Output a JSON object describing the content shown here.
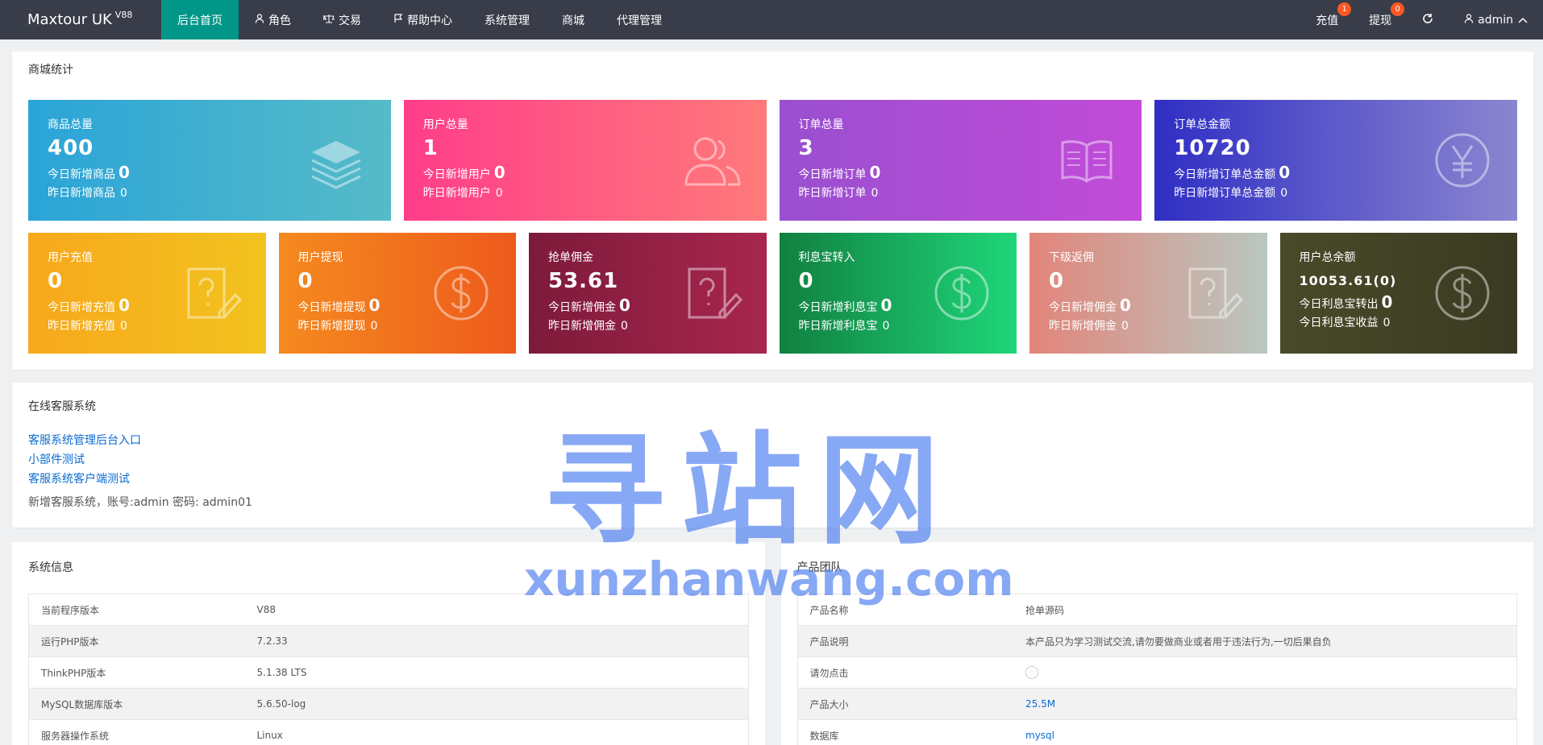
{
  "app": {
    "title": "Maxtour UK",
    "version": "V88"
  },
  "nav": [
    {
      "label": "后台首页",
      "icon": "",
      "active": true
    },
    {
      "label": "角色",
      "icon": "user-icon"
    },
    {
      "label": "交易",
      "icon": "scale-icon"
    },
    {
      "label": "帮助中心",
      "icon": "flag-icon"
    },
    {
      "label": "系统管理",
      "icon": ""
    },
    {
      "label": "商城",
      "icon": ""
    },
    {
      "label": "代理管理",
      "icon": ""
    }
  ],
  "right_nav": {
    "recharge": {
      "label": "充值",
      "badge": "1"
    },
    "withdraw": {
      "label": "提现",
      "badge": "0"
    },
    "refresh_icon": "refresh-icon",
    "user": {
      "label": "admin"
    }
  },
  "stats": {
    "title": "商城统计",
    "row1": [
      {
        "title": "商品总量",
        "value": "400",
        "l1_label": "今日新增商品",
        "l1_value": "0",
        "l2_label": "昨日新增商品",
        "l2_value": "0",
        "icon": "layers-icon",
        "color": "#2aa4d8"
      },
      {
        "title": "用户总量",
        "value": "1",
        "l1_label": "今日新增用户",
        "l1_value": "0",
        "l2_label": "昨日新增用户",
        "l2_value": "0",
        "icon": "users-icon",
        "color": "#ff3d8a"
      },
      {
        "title": "订单总量",
        "value": "3",
        "l1_label": "今日新增订单",
        "l1_value": "0",
        "l2_label": "昨日新增订单",
        "l2_value": "0",
        "icon": "book-icon",
        "color": "#9a4fd0"
      },
      {
        "title": "订单总金额",
        "value": "10720",
        "l1_label": "今日新增订单总金额",
        "l1_value": "0",
        "l2_label": "昨日新增订单总金额",
        "l2_value": "0",
        "icon": "yen-icon",
        "color": "#2f2ec4"
      }
    ],
    "row2": [
      {
        "title": "用户充值",
        "value": "0",
        "l1_label": "今日新增充值",
        "l1_value": "0",
        "l2_label": "昨日新增充值",
        "l2_value": "0",
        "icon": "question-note-icon",
        "color": "#f7a81c"
      },
      {
        "title": "用户提现",
        "value": "0",
        "l1_label": "今日新增提现",
        "l1_value": "0",
        "l2_label": "昨日新增提现",
        "l2_value": "0",
        "icon": "dollar-icon",
        "color": "#f58a1f"
      },
      {
        "title": "抢单佣金",
        "value": "53.61",
        "l1_label": "今日新增佣金",
        "l1_value": "0",
        "l2_label": "昨日新增佣金",
        "l2_value": "0",
        "icon": "question-note-icon",
        "color": "#7d1a3a"
      },
      {
        "title": "利息宝转入",
        "value": "0",
        "l1_label": "今日新增利息宝",
        "l1_value": "0",
        "l2_label": "昨日新增利息宝",
        "l2_value": "0",
        "icon": "dollar-icon",
        "color": "#118040"
      },
      {
        "title": "下级返佣",
        "value": "0",
        "l1_label": "今日新增佣金",
        "l1_value": "0",
        "l2_label": "昨日新增佣金",
        "l2_value": "0",
        "icon": "question-note-icon",
        "color": "#e2857a"
      },
      {
        "title": "用户总余额",
        "value": "10053.61(0)",
        "l1_label": "今日利息宝转出",
        "l1_value": "0",
        "l2_label": "今日利息宝收益",
        "l2_value": "0",
        "icon": "dollar-icon",
        "color": "#4a4a2a"
      }
    ]
  },
  "service": {
    "title": "在线客服系统",
    "links": [
      "客服系统管理后台入口",
      "小部件测试",
      "客服系统客户端测试"
    ],
    "note": "新增客服系统，账号:admin 密码: admin01"
  },
  "system_info": {
    "title": "系统信息",
    "rows": [
      {
        "k": "当前程序版本",
        "v": "V88"
      },
      {
        "k": "运行PHP版本",
        "v": "7.2.33"
      },
      {
        "k": "ThinkPHP版本",
        "v": "5.1.38 LTS"
      },
      {
        "k": "MySQL数据库版本",
        "v": "5.6.50-log"
      },
      {
        "k": "服务器操作系统",
        "v": "Linux"
      }
    ]
  },
  "product_team": {
    "title": "产品团队",
    "rows": [
      {
        "k": "产品名称",
        "v": "抢单源码"
      },
      {
        "k": "产品说明",
        "v": "本产品只为学习测试交流,请勿要做商业或者用于违法行为,一切后果自负"
      },
      {
        "k": "请勿点击",
        "v": "",
        "icon": "circle-icon"
      },
      {
        "k": "产品大小",
        "v": "25.5M",
        "link": true
      },
      {
        "k": "数据库",
        "v": "mysql",
        "link": true
      }
    ]
  },
  "watermark": {
    "main": "寻站网",
    "sub": "xunzhanwang.com"
  }
}
